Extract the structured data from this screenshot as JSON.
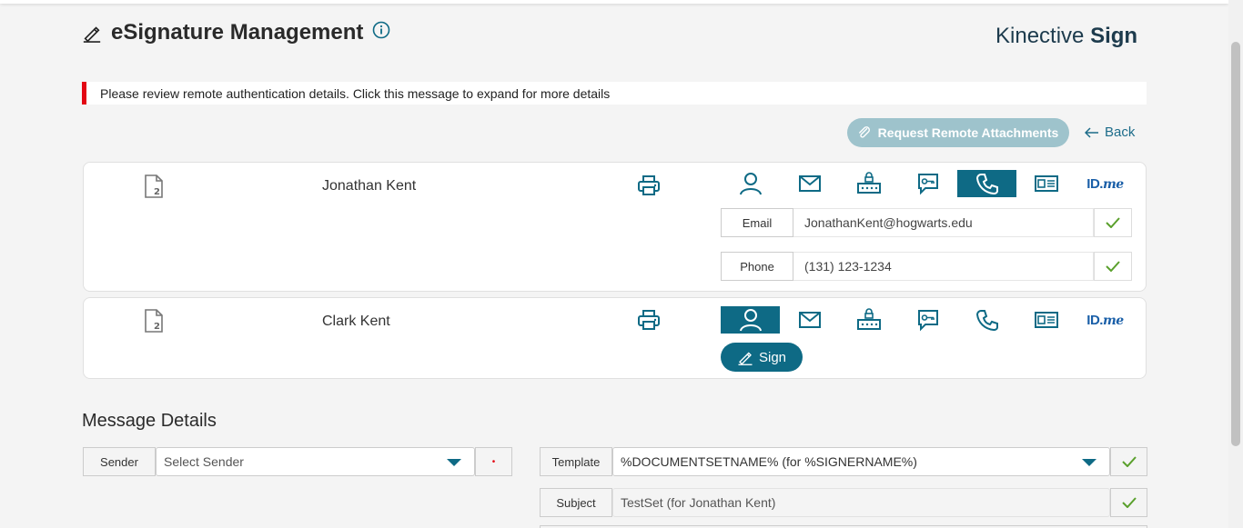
{
  "app": {
    "title": "eSignature Management",
    "brand_light": "Kinective ",
    "brand_bold": "Sign"
  },
  "alert": {
    "text": "Please review remote authentication details. Click this message to expand for more details"
  },
  "actions": {
    "request_remote_label": "Request Remote Attachments",
    "back_label": "Back"
  },
  "signers": [
    {
      "name": "Jonathan Kent",
      "active_auth": "phone-icon",
      "fields": [
        {
          "label": "Email",
          "value": "JonathanKent@hogwarts.edu"
        },
        {
          "label": "Phone",
          "value": "(131) 123-1234"
        }
      ]
    },
    {
      "name": "Clark Kent",
      "active_auth": "person-icon",
      "sign_label": "Sign"
    }
  ],
  "auth_tabs": [
    "person-icon",
    "mail-icon",
    "password-icon",
    "chat-key-icon",
    "phone-icon",
    "id-card-icon",
    "idme-icon"
  ],
  "idme": {
    "id": "ID.",
    "me": "me"
  },
  "message_details": {
    "title": "Message Details",
    "sender_label": "Sender",
    "sender_placeholder": "Select Sender",
    "required_marker": "•",
    "template_label": "Template",
    "template_value": "%DOCUMENTSETNAME% (for %SIGNERNAME%)",
    "subject_label": "Subject",
    "subject_value": "TestSet (for Jonathan Kent)"
  },
  "colors": {
    "accent": "#0e6a85",
    "alert_bar": "#e30613",
    "check": "#5aa02c"
  }
}
